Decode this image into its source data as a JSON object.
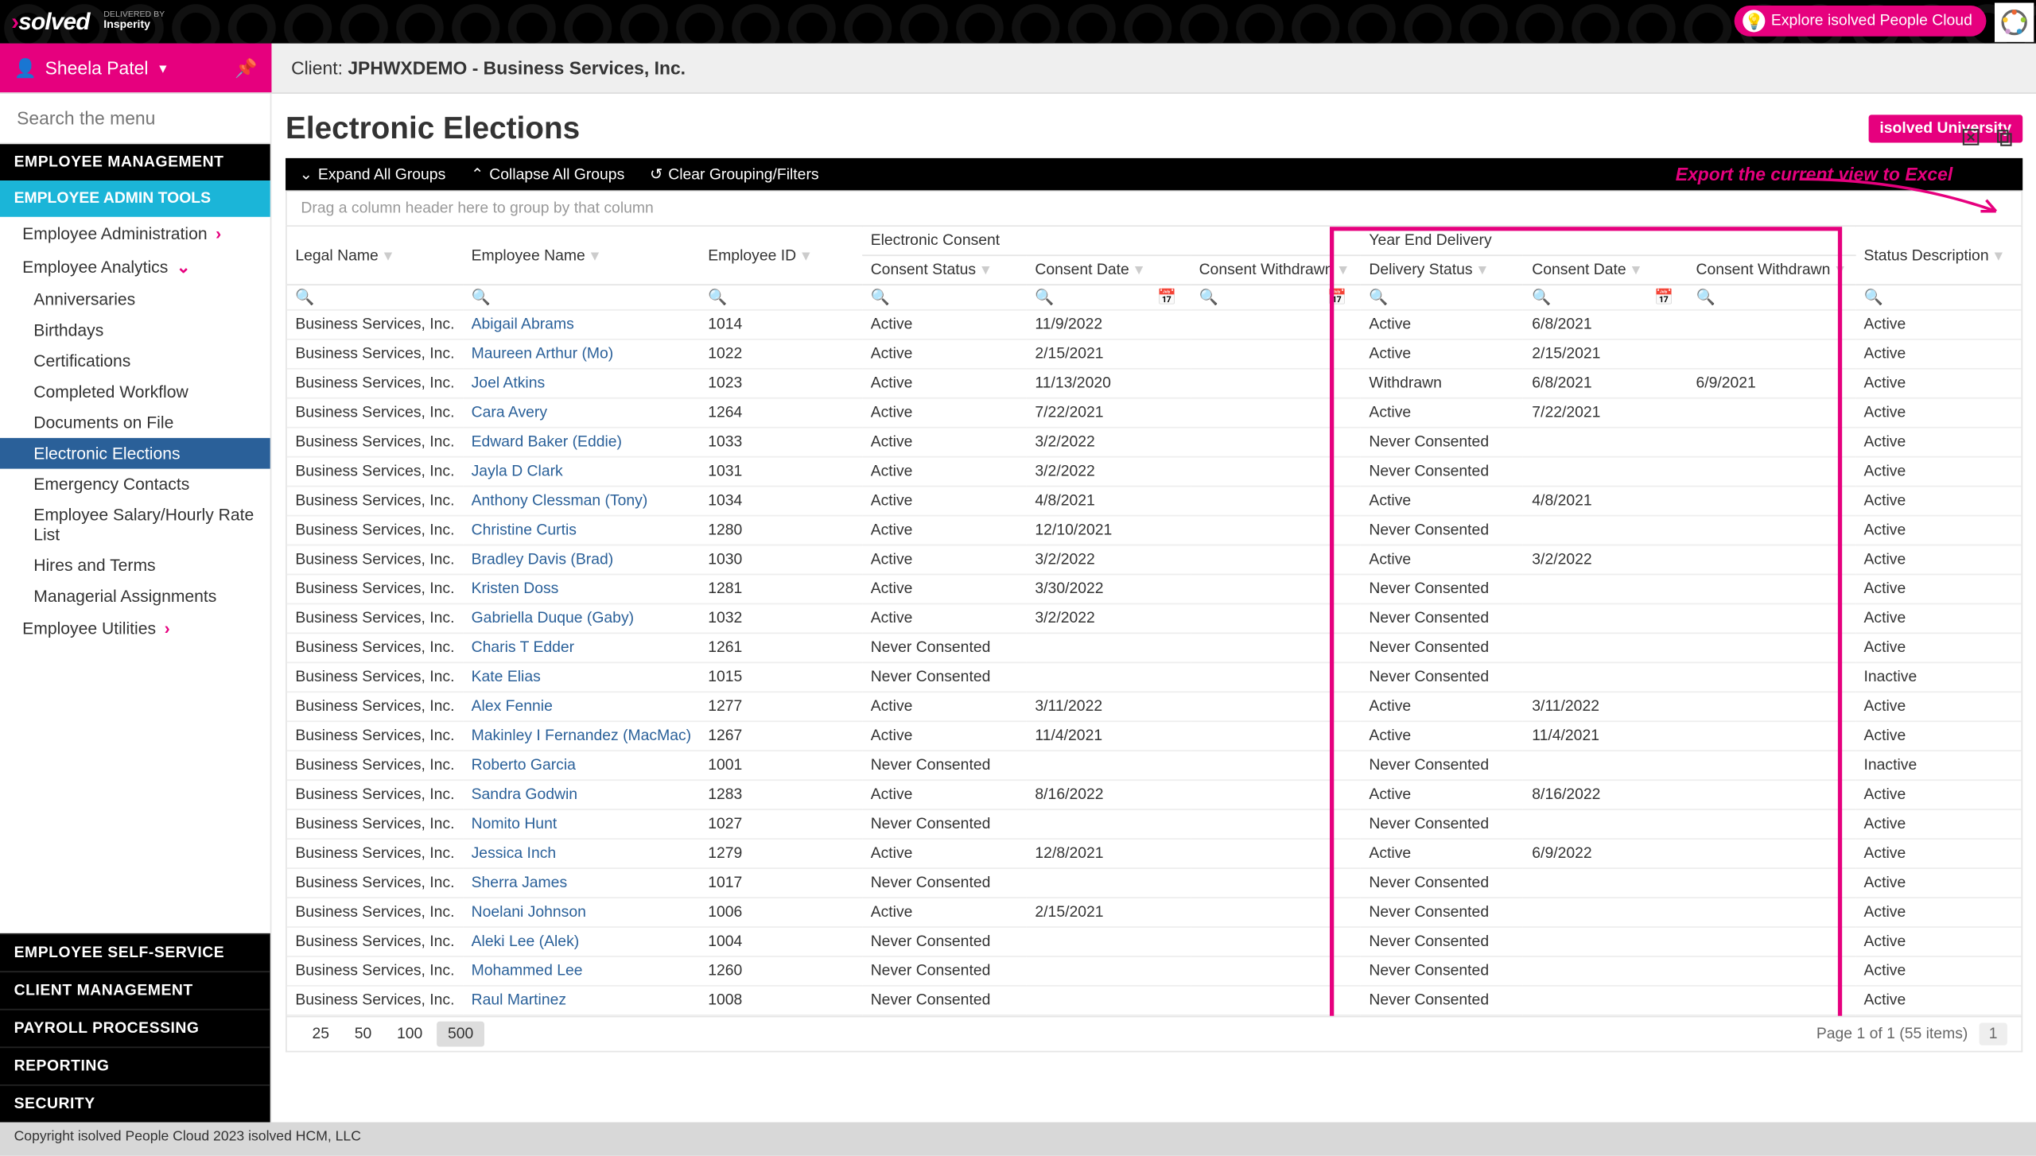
{
  "brand": {
    "name": "isolved",
    "delivered_by_label": "DELIVERED BY",
    "delivered_by": "Insperity",
    "explore_label": "Explore isolved People Cloud"
  },
  "user": {
    "name": "Sheela Patel"
  },
  "client": {
    "prefix": "Client: ",
    "name": "JPHWXDEMO - Business Services, Inc."
  },
  "search": {
    "placeholder": "Search the menu"
  },
  "nav": {
    "section1": "EMPLOYEE MANAGEMENT",
    "section2": "EMPLOYEE ADMIN TOOLS",
    "emp_admin": "Employee Administration",
    "emp_analytics": "Employee Analytics",
    "emp_utilities": "Employee Utilities",
    "sub_items": [
      "Anniversaries",
      "Birthdays",
      "Certifications",
      "Completed Workflow",
      "Documents on File",
      "Electronic Elections",
      "Emergency Contacts",
      "Employee Salary/Hourly Rate List",
      "Hires and Terms",
      "Managerial Assignments"
    ],
    "bottom": [
      "EMPLOYEE SELF-SERVICE",
      "CLIENT MANAGEMENT",
      "PAYROLL PROCESSING",
      "REPORTING",
      "SECURITY"
    ]
  },
  "page": {
    "title": "Electronic Elections",
    "uni_button": "isolved University"
  },
  "toolbar": {
    "expand": "Expand All Groups",
    "collapse": "Collapse All Groups",
    "clear": "Clear Grouping/Filters"
  },
  "callout": "Export the current view to Excel",
  "group_drop": "Drag a column header here to group by that column",
  "columns": {
    "legal_name": "Legal Name",
    "employee_name": "Employee Name",
    "employee_id": "Employee ID",
    "electronic_consent": "Electronic Consent",
    "consent_status": "Consent Status",
    "consent_date": "Consent Date",
    "consent_withdrawn": "Consent Withdrawn",
    "year_end": "Year End Delivery",
    "delivery_status": "Delivery Status",
    "d_consent_date": "Consent Date",
    "d_consent_withdrawn": "Consent Withdrawn",
    "status_desc": "Status Description"
  },
  "rows": [
    {
      "legal": "Business Services, Inc.",
      "emp": "Abigail Abrams",
      "id": "1014",
      "cstat": "Active",
      "cdate": "11/9/2022",
      "cwith": "",
      "dstat": "Active",
      "ddate": "6/8/2021",
      "dwith": "",
      "status": "Active"
    },
    {
      "legal": "Business Services, Inc.",
      "emp": "Maureen Arthur (Mo)",
      "id": "1022",
      "cstat": "Active",
      "cdate": "2/15/2021",
      "cwith": "",
      "dstat": "Active",
      "ddate": "2/15/2021",
      "dwith": "",
      "status": "Active"
    },
    {
      "legal": "Business Services, Inc.",
      "emp": "Joel Atkins",
      "id": "1023",
      "cstat": "Active",
      "cdate": "11/13/2020",
      "cwith": "",
      "dstat": "Withdrawn",
      "ddate": "6/8/2021",
      "dwith": "6/9/2021",
      "status": "Active"
    },
    {
      "legal": "Business Services, Inc.",
      "emp": "Cara Avery",
      "id": "1264",
      "cstat": "Active",
      "cdate": "7/22/2021",
      "cwith": "",
      "dstat": "Active",
      "ddate": "7/22/2021",
      "dwith": "",
      "status": "Active"
    },
    {
      "legal": "Business Services, Inc.",
      "emp": "Edward Baker (Eddie)",
      "id": "1033",
      "cstat": "Active",
      "cdate": "3/2/2022",
      "cwith": "",
      "dstat": "Never Consented",
      "ddate": "",
      "dwith": "",
      "status": "Active"
    },
    {
      "legal": "Business Services, Inc.",
      "emp": "Jayla D Clark",
      "id": "1031",
      "cstat": "Active",
      "cdate": "3/2/2022",
      "cwith": "",
      "dstat": "Never Consented",
      "ddate": "",
      "dwith": "",
      "status": "Active"
    },
    {
      "legal": "Business Services, Inc.",
      "emp": "Anthony Clessman (Tony)",
      "id": "1034",
      "cstat": "Active",
      "cdate": "4/8/2021",
      "cwith": "",
      "dstat": "Active",
      "ddate": "4/8/2021",
      "dwith": "",
      "status": "Active"
    },
    {
      "legal": "Business Services, Inc.",
      "emp": "Christine Curtis",
      "id": "1280",
      "cstat": "Active",
      "cdate": "12/10/2021",
      "cwith": "",
      "dstat": "Never Consented",
      "ddate": "",
      "dwith": "",
      "status": "Active"
    },
    {
      "legal": "Business Services, Inc.",
      "emp": "Bradley Davis (Brad)",
      "id": "1030",
      "cstat": "Active",
      "cdate": "3/2/2022",
      "cwith": "",
      "dstat": "Active",
      "ddate": "3/2/2022",
      "dwith": "",
      "status": "Active"
    },
    {
      "legal": "Business Services, Inc.",
      "emp": "Kristen Doss",
      "id": "1281",
      "cstat": "Active",
      "cdate": "3/30/2022",
      "cwith": "",
      "dstat": "Never Consented",
      "ddate": "",
      "dwith": "",
      "status": "Active"
    },
    {
      "legal": "Business Services, Inc.",
      "emp": "Gabriella Duque (Gaby)",
      "id": "1032",
      "cstat": "Active",
      "cdate": "3/2/2022",
      "cwith": "",
      "dstat": "Never Consented",
      "ddate": "",
      "dwith": "",
      "status": "Active"
    },
    {
      "legal": "Business Services, Inc.",
      "emp": "Charis T Edder",
      "id": "1261",
      "cstat": "Never Consented",
      "cdate": "",
      "cwith": "",
      "dstat": "Never Consented",
      "ddate": "",
      "dwith": "",
      "status": "Active"
    },
    {
      "legal": "Business Services, Inc.",
      "emp": "Kate Elias",
      "id": "1015",
      "cstat": "Never Consented",
      "cdate": "",
      "cwith": "",
      "dstat": "Never Consented",
      "ddate": "",
      "dwith": "",
      "status": "Inactive"
    },
    {
      "legal": "Business Services, Inc.",
      "emp": "Alex Fennie",
      "id": "1277",
      "cstat": "Active",
      "cdate": "3/11/2022",
      "cwith": "",
      "dstat": "Active",
      "ddate": "3/11/2022",
      "dwith": "",
      "status": "Active"
    },
    {
      "legal": "Business Services, Inc.",
      "emp": "Makinley I Fernandez (MacMac)",
      "id": "1267",
      "cstat": "Active",
      "cdate": "11/4/2021",
      "cwith": "",
      "dstat": "Active",
      "ddate": "11/4/2021",
      "dwith": "",
      "status": "Active"
    },
    {
      "legal": "Business Services, Inc.",
      "emp": "Roberto Garcia",
      "id": "1001",
      "cstat": "Never Consented",
      "cdate": "",
      "cwith": "",
      "dstat": "Never Consented",
      "ddate": "",
      "dwith": "",
      "status": "Inactive"
    },
    {
      "legal": "Business Services, Inc.",
      "emp": "Sandra Godwin",
      "id": "1283",
      "cstat": "Active",
      "cdate": "8/16/2022",
      "cwith": "",
      "dstat": "Active",
      "ddate": "8/16/2022",
      "dwith": "",
      "status": "Active"
    },
    {
      "legal": "Business Services, Inc.",
      "emp": "Nomito Hunt",
      "id": "1027",
      "cstat": "Never Consented",
      "cdate": "",
      "cwith": "",
      "dstat": "Never Consented",
      "ddate": "",
      "dwith": "",
      "status": "Active"
    },
    {
      "legal": "Business Services, Inc.",
      "emp": "Jessica Inch",
      "id": "1279",
      "cstat": "Active",
      "cdate": "12/8/2021",
      "cwith": "",
      "dstat": "Active",
      "ddate": "6/9/2022",
      "dwith": "",
      "status": "Active"
    },
    {
      "legal": "Business Services, Inc.",
      "emp": "Sherra James",
      "id": "1017",
      "cstat": "Never Consented",
      "cdate": "",
      "cwith": "",
      "dstat": "Never Consented",
      "ddate": "",
      "dwith": "",
      "status": "Active"
    },
    {
      "legal": "Business Services, Inc.",
      "emp": "Noelani Johnson",
      "id": "1006",
      "cstat": "Active",
      "cdate": "2/15/2021",
      "cwith": "",
      "dstat": "Never Consented",
      "ddate": "",
      "dwith": "",
      "status": "Active"
    },
    {
      "legal": "Business Services, Inc.",
      "emp": "Aleki Lee (Alek)",
      "id": "1004",
      "cstat": "Never Consented",
      "cdate": "",
      "cwith": "",
      "dstat": "Never Consented",
      "ddate": "",
      "dwith": "",
      "status": "Active"
    },
    {
      "legal": "Business Services, Inc.",
      "emp": "Mohammed Lee",
      "id": "1260",
      "cstat": "Never Consented",
      "cdate": "",
      "cwith": "",
      "dstat": "Never Consented",
      "ddate": "",
      "dwith": "",
      "status": "Active"
    },
    {
      "legal": "Business Services, Inc.",
      "emp": "Raul Martinez",
      "id": "1008",
      "cstat": "Never Consented",
      "cdate": "",
      "cwith": "",
      "dstat": "Never Consented",
      "ddate": "",
      "dwith": "",
      "status": "Active"
    }
  ],
  "pager": {
    "sizes": [
      "25",
      "50",
      "100",
      "500"
    ],
    "active_size": "500",
    "info": "Page 1 of 1 (55 items)",
    "page": "1"
  },
  "footer": "Copyright isolved People Cloud 2023 isolved HCM, LLC"
}
